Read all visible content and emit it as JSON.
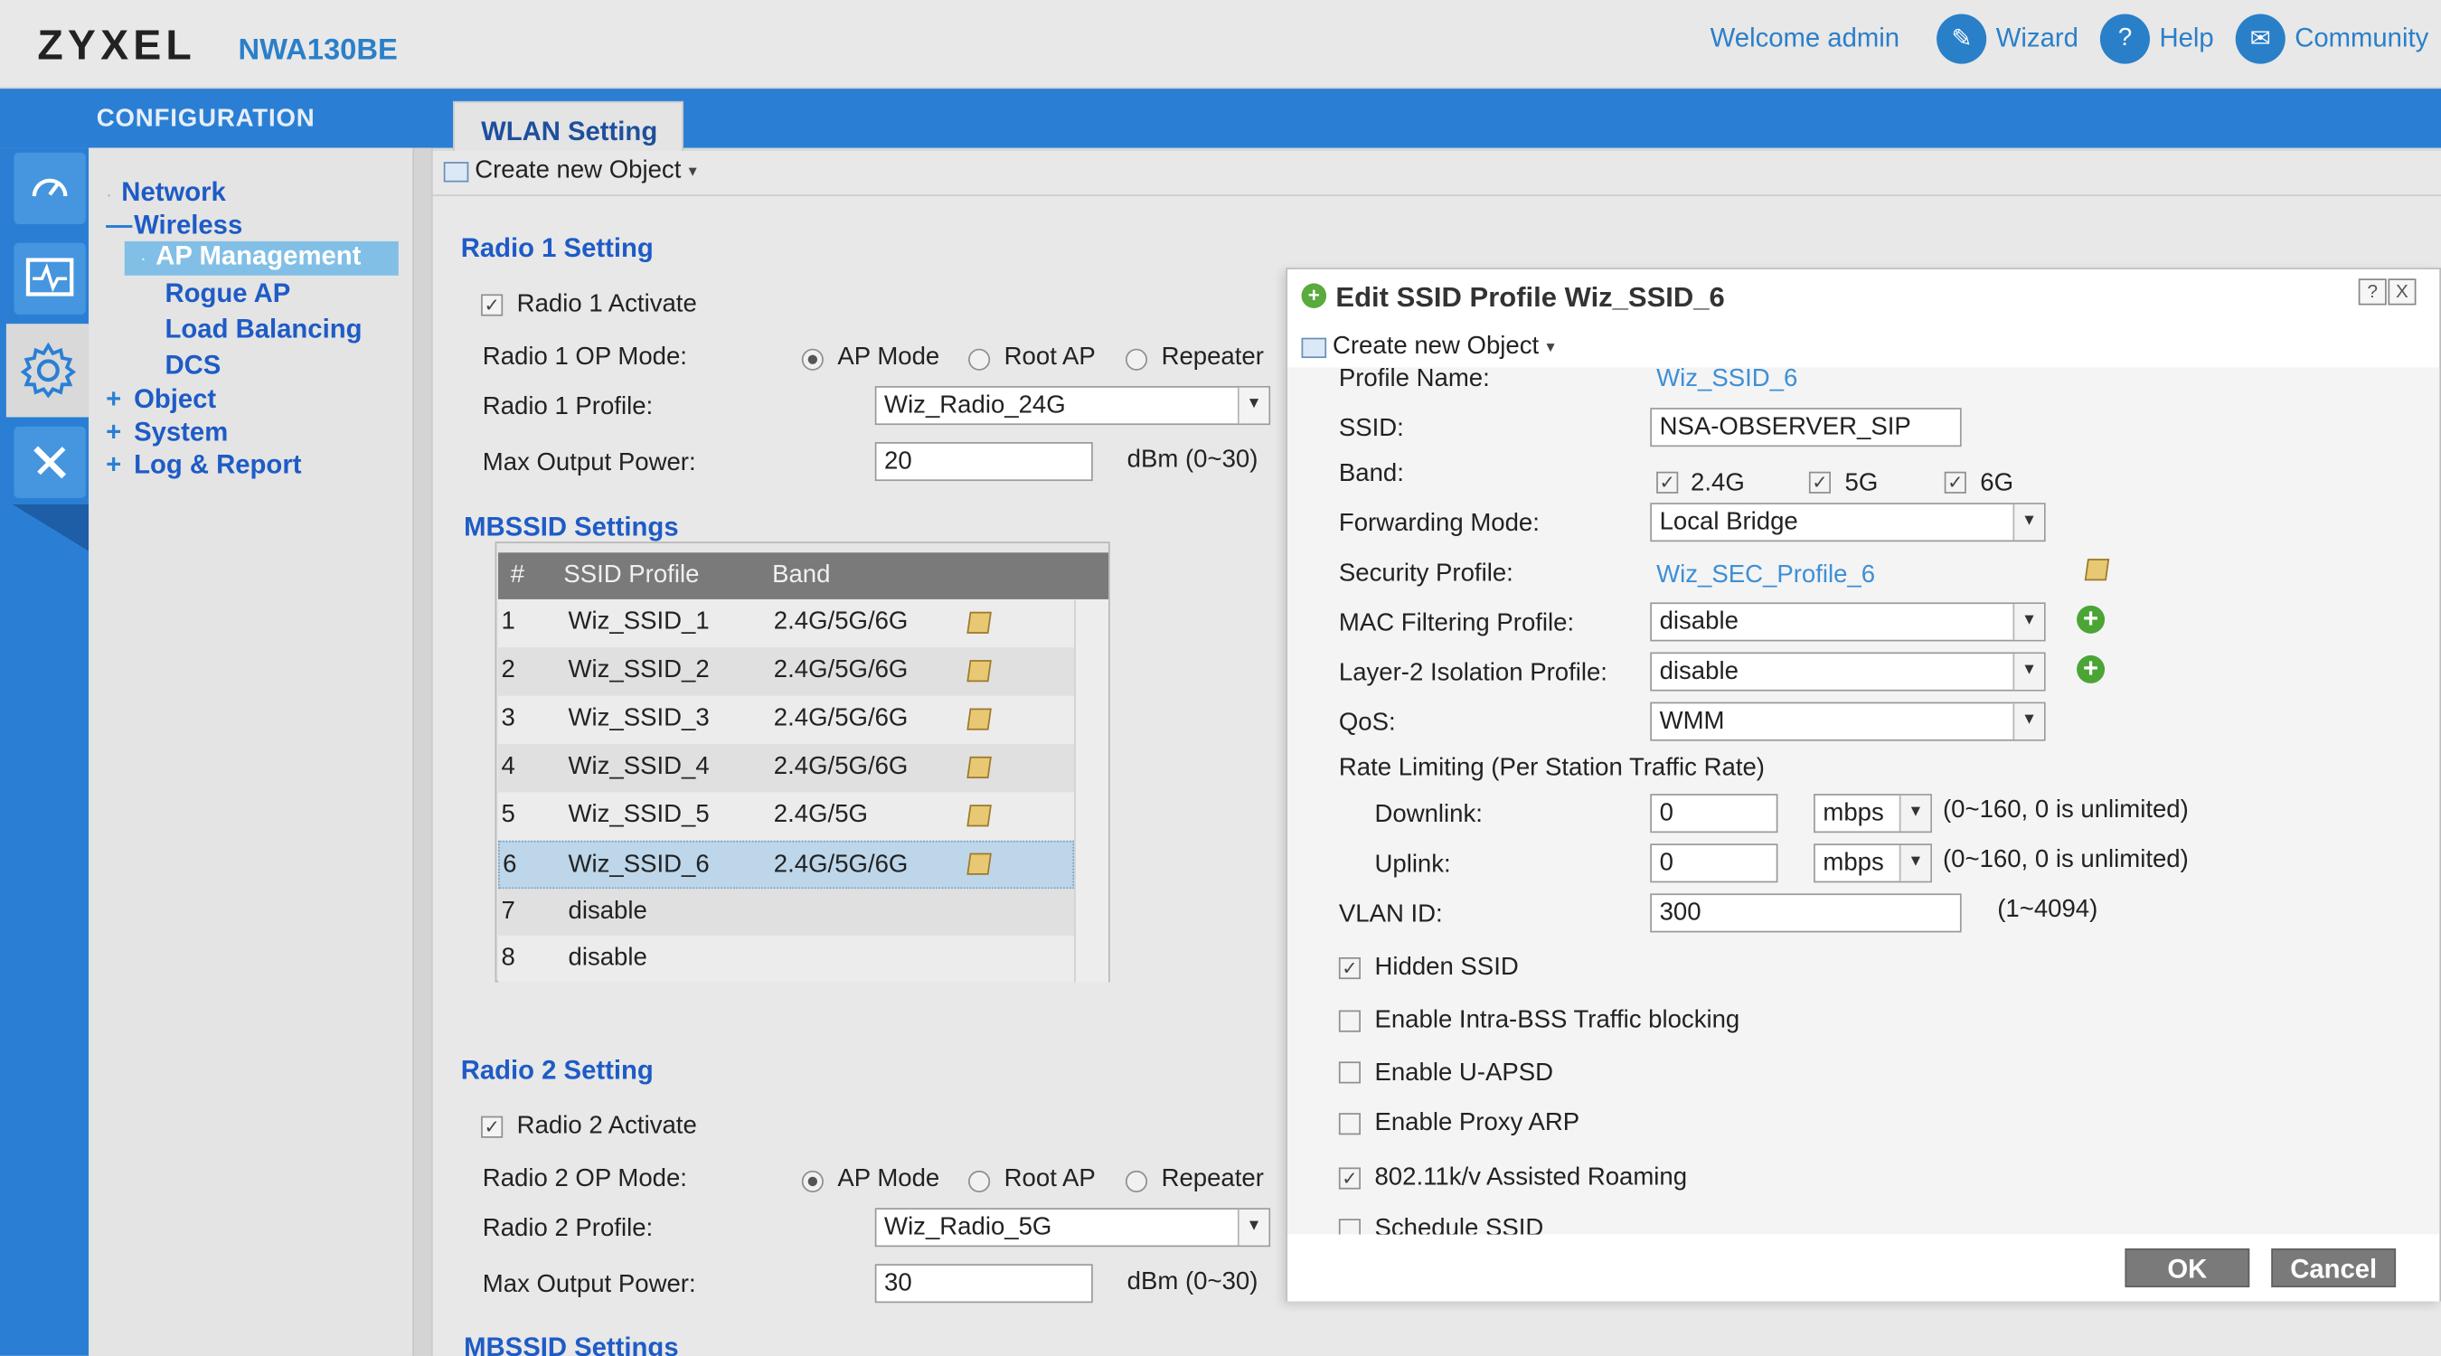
{
  "header": {
    "brand": "ZYXEL",
    "model": "NWA130BE",
    "welcome": "Welcome admin",
    "wizard": "Wizard",
    "help": "Help",
    "community": "Community"
  },
  "config_title": "CONFIGURATION",
  "tab_label": "WLAN Setting",
  "nav": {
    "network": "Network",
    "wireless": "Wireless",
    "ap_management": "AP Management",
    "rogue_ap": "Rogue AP",
    "load_balancing": "Load Balancing",
    "dcs": "DCS",
    "object": "Object",
    "system": "System",
    "log_report": "Log & Report"
  },
  "create_object": "Create new Object",
  "radio1": {
    "section": "Radio 1 Setting",
    "activate": "Radio 1 Activate",
    "op_mode_label": "Radio 1 OP Mode:",
    "mode_ap": "AP Mode",
    "mode_root": "Root AP",
    "mode_repeater": "Repeater",
    "profile_label": "Radio 1 Profile:",
    "profile_value": "Wiz_Radio_24G",
    "power_label": "Max Output Power:",
    "power_value": "20",
    "power_unit": "dBm (0~30)"
  },
  "mbssid": {
    "section": "MBSSID Settings",
    "col_num": "#",
    "col_profile": "SSID Profile",
    "col_band": "Band",
    "rows": [
      {
        "n": "1",
        "profile": "Wiz_SSID_1",
        "band": "2.4G/5G/6G"
      },
      {
        "n": "2",
        "profile": "Wiz_SSID_2",
        "band": "2.4G/5G/6G"
      },
      {
        "n": "3",
        "profile": "Wiz_SSID_3",
        "band": "2.4G/5G/6G"
      },
      {
        "n": "4",
        "profile": "Wiz_SSID_4",
        "band": "2.4G/5G/6G"
      },
      {
        "n": "5",
        "profile": "Wiz_SSID_5",
        "band": "2.4G/5G"
      },
      {
        "n": "6",
        "profile": "Wiz_SSID_6",
        "band": "2.4G/5G/6G"
      },
      {
        "n": "7",
        "profile": "disable",
        "band": ""
      },
      {
        "n": "8",
        "profile": "disable",
        "band": ""
      }
    ]
  },
  "radio2": {
    "section": "Radio 2 Setting",
    "activate": "Radio 2 Activate",
    "op_mode_label": "Radio 2 OP Mode:",
    "mode_ap": "AP Mode",
    "mode_root": "Root AP",
    "mode_repeater": "Repeater",
    "profile_label": "Radio 2 Profile:",
    "profile_value": "Wiz_Radio_5G",
    "power_label": "Max Output Power:",
    "power_value": "30",
    "power_unit": "dBm (0~30)",
    "mbssid_section": "MBSSID Settings"
  },
  "dialog": {
    "title": "Edit SSID Profile Wiz_SSID_6",
    "help_btn": "?",
    "close_btn": "X",
    "create_object": "Create new Object",
    "profile_name_label": "Profile Name:",
    "profile_name_value": "Wiz_SSID_6",
    "ssid_label": "SSID:",
    "ssid_value": "NSA-OBSERVER_SIP",
    "band_label": "Band:",
    "band_24": "2.4G",
    "band_5": "5G",
    "band_6": "6G",
    "forwarding_label": "Forwarding Mode:",
    "forwarding_value": "Local Bridge",
    "security_label": "Security Profile:",
    "security_value": "Wiz_SEC_Profile_6",
    "mac_label": "MAC Filtering Profile:",
    "mac_value": "disable",
    "l2_label": "Layer-2 Isolation Profile:",
    "l2_value": "disable",
    "qos_label": "QoS:",
    "qos_value": "WMM",
    "rate_label": "Rate Limiting (Per Station Traffic Rate)",
    "downlink_label": "Downlink:",
    "downlink_value": "0",
    "downlink_unit": "mbps",
    "downlink_hint": "(0~160, 0 is unlimited)",
    "uplink_label": "Uplink:",
    "uplink_value": "0",
    "uplink_unit": "mbps",
    "uplink_hint": "(0~160, 0 is unlimited)",
    "vlan_label": "VLAN ID:",
    "vlan_value": "300",
    "vlan_hint": "(1~4094)",
    "hidden_ssid": "Hidden SSID",
    "intra_bss": "Enable Intra-BSS Traffic blocking",
    "uapsd": "Enable U-APSD",
    "proxy_arp": "Enable Proxy ARP",
    "roaming": "802.11k/v Assisted Roaming",
    "schedule": "Schedule SSID",
    "ok": "OK",
    "cancel": "Cancel"
  },
  "colors": {
    "accent_blue": "#2a7fd4",
    "nav_text": "#1e5bc6",
    "link": "#3d8fd6",
    "selected_nav": "#82bfe6"
  }
}
